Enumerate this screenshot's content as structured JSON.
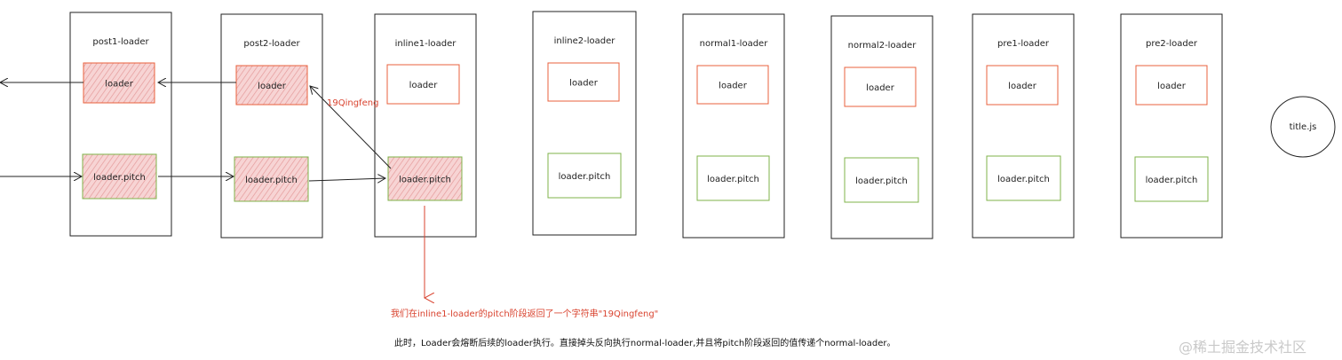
{
  "columns": [
    {
      "title": "post1-loader",
      "loader_label": "loader",
      "pitch_label": "loader.pitch",
      "highlighted": true
    },
    {
      "title": "post2-loader",
      "loader_label": "loader",
      "pitch_label": "loader.pitch",
      "highlighted": true
    },
    {
      "title": "inline1-loader",
      "loader_label": "loader",
      "pitch_label": "loader.pitch",
      "highlighted": false,
      "pitch_highlighted": true
    },
    {
      "title": "inline2-loader",
      "loader_label": "loader",
      "pitch_label": "loader.pitch",
      "highlighted": false
    },
    {
      "title": "normal1-loader",
      "loader_label": "loader",
      "pitch_label": "loader.pitch",
      "highlighted": false
    },
    {
      "title": "normal2-loader",
      "loader_label": "loader",
      "pitch_label": "loader.pitch",
      "highlighted": false
    },
    {
      "title": "pre1-loader",
      "loader_label": "loader",
      "pitch_label": "loader.pitch",
      "highlighted": false
    },
    {
      "title": "pre2-loader",
      "loader_label": "loader",
      "pitch_label": "loader.pitch",
      "highlighted": false
    }
  ],
  "resource_label": "title.js",
  "return_value_label": "19Qingfeng",
  "annotation_red": "我们在inline1-loader的pitch阶段返回了一个字符串\"19Qingfeng\"",
  "annotation_black": "此时，Loader会熔断后续的loader执行。直接掉头反向执行normal-loader,并且将pitch阶段返回的值传递个normal-loader。",
  "watermark": "@稀土掘金技术社区",
  "colors": {
    "loader_stroke": "#e8603c",
    "pitch_stroke": "#7fb34a",
    "highlight_fill": "#f5c2c2",
    "annotation": "#d9432f",
    "frame": "#222222"
  }
}
